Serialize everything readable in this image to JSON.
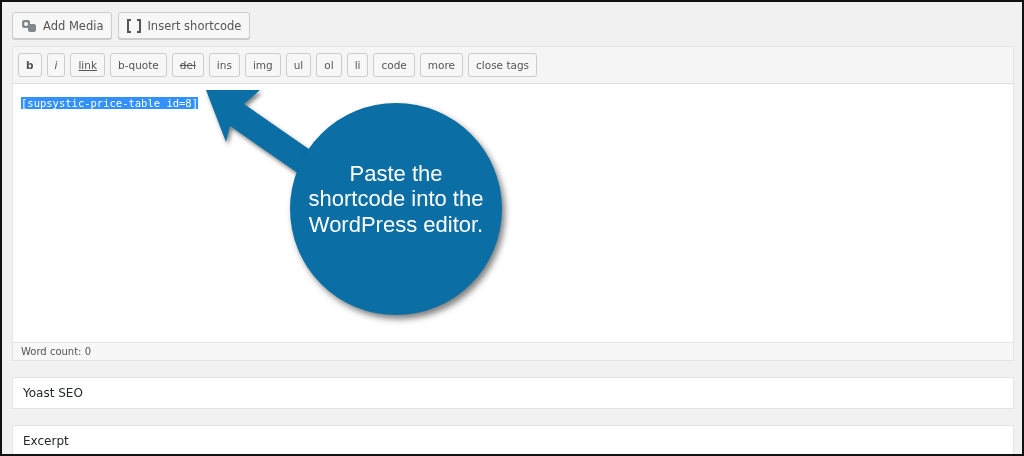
{
  "media_buttons": [
    {
      "label": "Add Media",
      "kind": "media"
    },
    {
      "label": "Insert shortcode",
      "kind": "shortcode"
    }
  ],
  "quicktags": [
    {
      "label": "b",
      "kind": "bold"
    },
    {
      "label": "i",
      "kind": "italic"
    },
    {
      "label": "link",
      "kind": "underline"
    },
    {
      "label": "b-quote",
      "kind": "plain"
    },
    {
      "label": "del",
      "kind": "strike"
    },
    {
      "label": "ins",
      "kind": "plain"
    },
    {
      "label": "img",
      "kind": "plain"
    },
    {
      "label": "ul",
      "kind": "plain"
    },
    {
      "label": "ol",
      "kind": "plain"
    },
    {
      "label": "li",
      "kind": "plain"
    },
    {
      "label": "code",
      "kind": "plain"
    },
    {
      "label": "more",
      "kind": "plain"
    },
    {
      "label": "close tags",
      "kind": "plain"
    }
  ],
  "editor": {
    "content": "[supsystic-price-table id=8]",
    "selected": true
  },
  "callout": {
    "text": "Paste the shortcode into the WordPress editor."
  },
  "word_count": "Word count: 0",
  "panels": [
    {
      "title": "Yoast SEO"
    },
    {
      "title": "Excerpt"
    }
  ]
}
